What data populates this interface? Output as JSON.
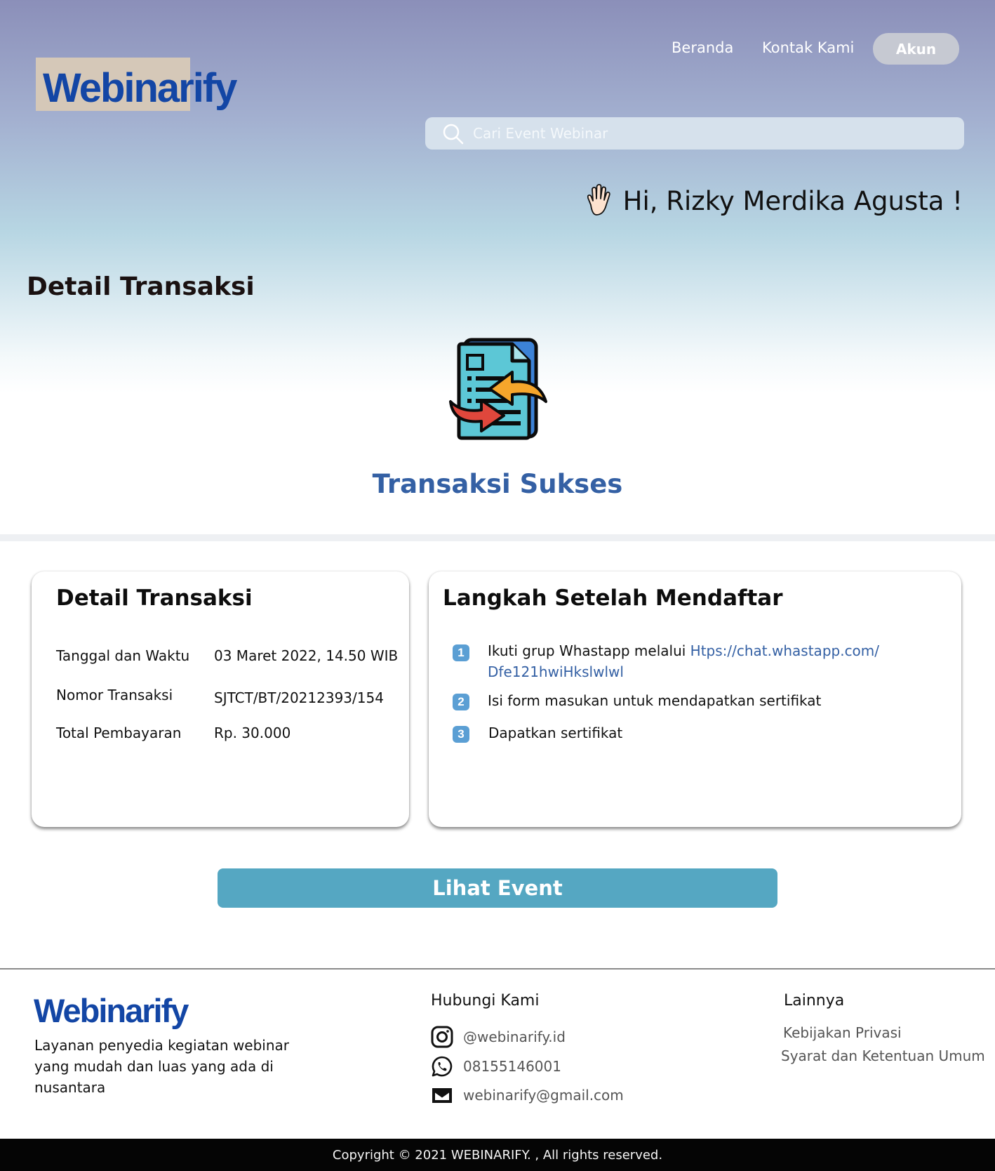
{
  "header": {
    "logo": "Webinarify",
    "nav": {
      "home": "Beranda",
      "contact": "Kontak Kami",
      "account": "Akun"
    },
    "search": {
      "placeholder": "Cari Event Webinar",
      "value": ""
    },
    "greeting": "Hi, Rizky Merdika Agusta !"
  },
  "main": {
    "page_title": "Detail Transaksi",
    "status": "Transaksi Sukses"
  },
  "transaction_card": {
    "title": "Detail Transaksi",
    "rows": [
      {
        "label": "Tanggal dan Waktu",
        "value": "03 Maret 2022,  14.50 WIB"
      },
      {
        "label": "Nomor Transaksi",
        "value": "SJTCT/BT/20212393/154"
      },
      {
        "label": "Total Pembayaran",
        "value": "Rp. 30.000"
      }
    ]
  },
  "steps_card": {
    "title": "Langkah Setelah Mendaftar",
    "steps": [
      {
        "num": "1",
        "text": "Ikuti grup Whastapp melalui ",
        "link": "Htps://chat.whastapp.com/ Dfe121hwiHkslwlwl"
      },
      {
        "num": "2",
        "text": "Isi form masukan untuk mendapatkan sertifikat"
      },
      {
        "num": "3",
        "text": "Dapatkan sertifikat"
      }
    ]
  },
  "cta": {
    "label": "Lihat Event"
  },
  "footer": {
    "logo": "Webinarify",
    "description": "Layanan penyedia kegiatan webinar yang mudah dan luas yang ada di nusantara",
    "contact_heading": "Hubungi Kami",
    "contacts": [
      {
        "icon": "instagram-icon",
        "text": "@webinarify.id"
      },
      {
        "icon": "whatsapp-icon",
        "text": "08155146001"
      },
      {
        "icon": "mail-icon",
        "text": "webinarify@gmail.com"
      }
    ],
    "other_heading": "Lainnya",
    "other_links": [
      "Kebijakan Privasi",
      "Syarat dan Ketentuan Umum"
    ],
    "copyright": "Copyright © 2021 WEBINARIFY. , All rights reserved."
  },
  "colors": {
    "brand": "#1346a5",
    "accent": "#3460a4",
    "button": "#55a7c2"
  }
}
